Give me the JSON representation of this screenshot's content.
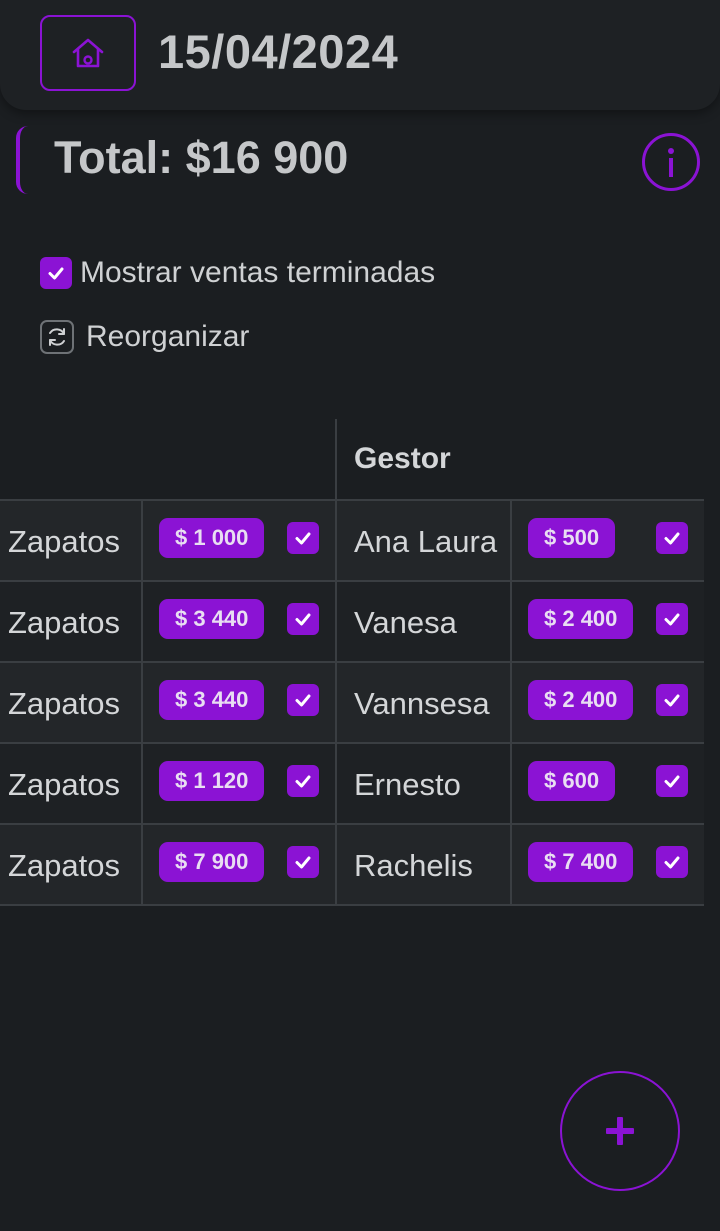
{
  "header": {
    "date": "15/04/2024",
    "home_icon": "home-icon"
  },
  "summary": {
    "total_label": "Total: $16 900",
    "info_icon": "info-icon"
  },
  "options": {
    "show_finished_label": "Mostrar ventas terminadas",
    "show_finished_checked": true,
    "reorganize_label": "Reorganizar"
  },
  "table": {
    "headers": [
      "",
      "",
      "Gestor",
      ""
    ],
    "rows": [
      {
        "product": "Zapatos",
        "amount": "$ 1 000",
        "gestor": "Ana Laura",
        "commission": "$ 500"
      },
      {
        "product": "Zapatos",
        "amount": "$ 3 440",
        "gestor": "Vanesa",
        "commission": "$ 2 400"
      },
      {
        "product": "Zapatos",
        "amount": "$ 3 440",
        "gestor": "Vannsesa",
        "commission": "$ 2 400"
      },
      {
        "product": "Zapatos",
        "amount": "$ 1 120",
        "gestor": "Ernesto",
        "commission": "$ 600"
      },
      {
        "product": "Zapatos",
        "amount": "$ 7 900",
        "gestor": "Rachelis",
        "commission": "$ 7 400"
      }
    ]
  },
  "fab": {
    "icon": "plus-icon"
  },
  "colors": {
    "accent": "#8b13d4",
    "background": "#1b1e21"
  }
}
